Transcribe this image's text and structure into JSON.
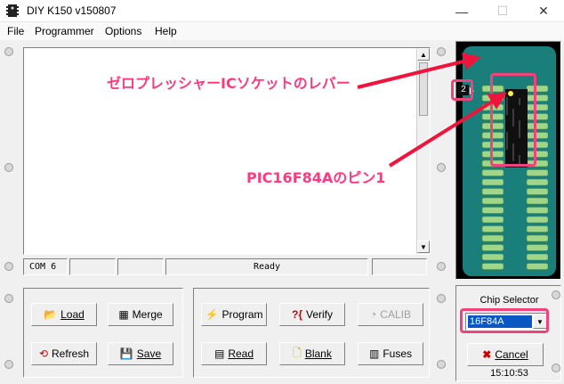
{
  "window": {
    "title": "DIY K150 v150807",
    "minimize_glyph": "—",
    "maximize_glyph": "☐",
    "close_glyph": "✕"
  },
  "menu": [
    "File",
    "Programmer",
    "Options",
    "Help"
  ],
  "status": {
    "port": "COM 6",
    "state": "Ready"
  },
  "socket": {
    "lever_label": "2"
  },
  "buttons": {
    "load": "Load",
    "merge": "Merge",
    "refresh": "Refresh",
    "save": "Save",
    "program": "Program",
    "verify": "Verify",
    "calib": "CALIB",
    "read": "Read",
    "blank": "Blank",
    "fuses": "Fuses",
    "cancel": "Cancel"
  },
  "icons": {
    "load": "folder-open-icon",
    "merge": "merge-icon",
    "refresh": "refresh-icon",
    "save": "floppy-disk-icon",
    "program": "program-chip-icon",
    "verify": "verify-icon",
    "calib": "calibrate-icon",
    "read": "read-chip-icon",
    "blank": "blank-page-icon",
    "fuses": "fuses-icon",
    "cancel": "cancel-x-icon"
  },
  "chip_selector": {
    "label": "Chip Selector",
    "selected": "16F84A"
  },
  "clock": "15:10:53",
  "annotations": {
    "lever": "ゼロプレッシャーICソケットのレバー",
    "pin1": "PIC16F84Aのピン1"
  },
  "colors": {
    "annotation": "#f0437e",
    "socket_board": "#1a7f7a",
    "selection": "#0a56c2"
  }
}
